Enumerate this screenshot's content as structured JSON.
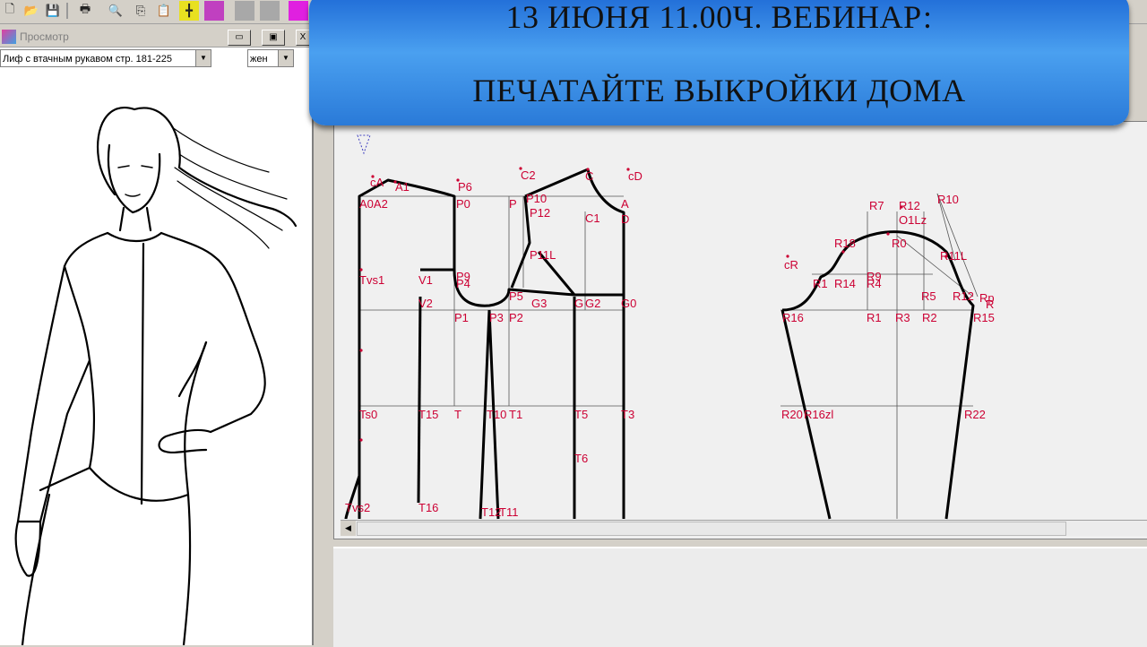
{
  "toolbar": {
    "icons": [
      "new-file-icon",
      "open-folder-icon",
      "save-icon",
      "print-icon",
      "print-preview-icon",
      "copy-icon",
      "paste-icon",
      "grid-icon",
      "image-icon",
      "tile-icon",
      "tile-icon-2",
      "paint-icon"
    ]
  },
  "preview": {
    "title": "Просмотр",
    "minimize_label": "▭",
    "restore_label": "▣",
    "close_label": "X",
    "pattern_select": "Лиф с втачным рукавом стр. 181-225",
    "gender_select": "жен"
  },
  "banner": {
    "line1": "13 ИЮНЯ 11.00Ч. ВЕБИНАР:",
    "line2": "ПЕЧАТАЙТЕ ВЫКРОЙКИ ДОМА"
  },
  "colors": {
    "label_red": "#cc0033",
    "banner_blue": "#2a7ad8",
    "line_black": "#000000"
  },
  "bodice_labels": {
    "cA": "cA",
    "A1": "A1",
    "P6": "P6",
    "C2": "C2",
    "C": "C",
    "cD": "cD",
    "A0A2": "A0A2",
    "P0": "P0",
    "P": "P",
    "P10": "P10",
    "A": "A",
    "P12": "P12",
    "C1": "C1",
    "D": "D",
    "P11L": "P11L",
    "Tvs1": "Tvs1",
    "V1": "V1",
    "P9": "P9",
    "P4": "P4",
    "P5": "P5",
    "G3": "G3",
    "G": "G",
    "G2": "G2",
    "G0": "G0",
    "V2": "V2",
    "P1": "P1",
    "P3": "P3",
    "P2": "P2",
    "Ts0": "Ts0",
    "T15": "T15",
    "T": "T",
    "T10": "T10",
    "T1": "T1",
    "T5": "T5",
    "T3": "T3",
    "T6": "T6",
    "Tvs2": "Tvs2",
    "T16": "T16",
    "T12": "T12",
    "T11": "T11"
  },
  "sleeve_labels": {
    "R7": "R7",
    "R12": "R12",
    "R10": "R10",
    "O1Lz": "O1Lz",
    "R18": "R18",
    "R0": "R0",
    "R11L": "R11L",
    "cR": "cR",
    "R9": "R9",
    "R1": "R1",
    "R14": "R14",
    "R4": "R4",
    "R5": "R5",
    "R12b": "R12",
    "Rp": "Rp",
    "R": "R",
    "R16": "R16",
    "R1b": "R1",
    "R3": "R3",
    "R2": "R2",
    "R15": "R15",
    "R20": "R20",
    "R16zl": "R16zl",
    "R22": "R22"
  }
}
